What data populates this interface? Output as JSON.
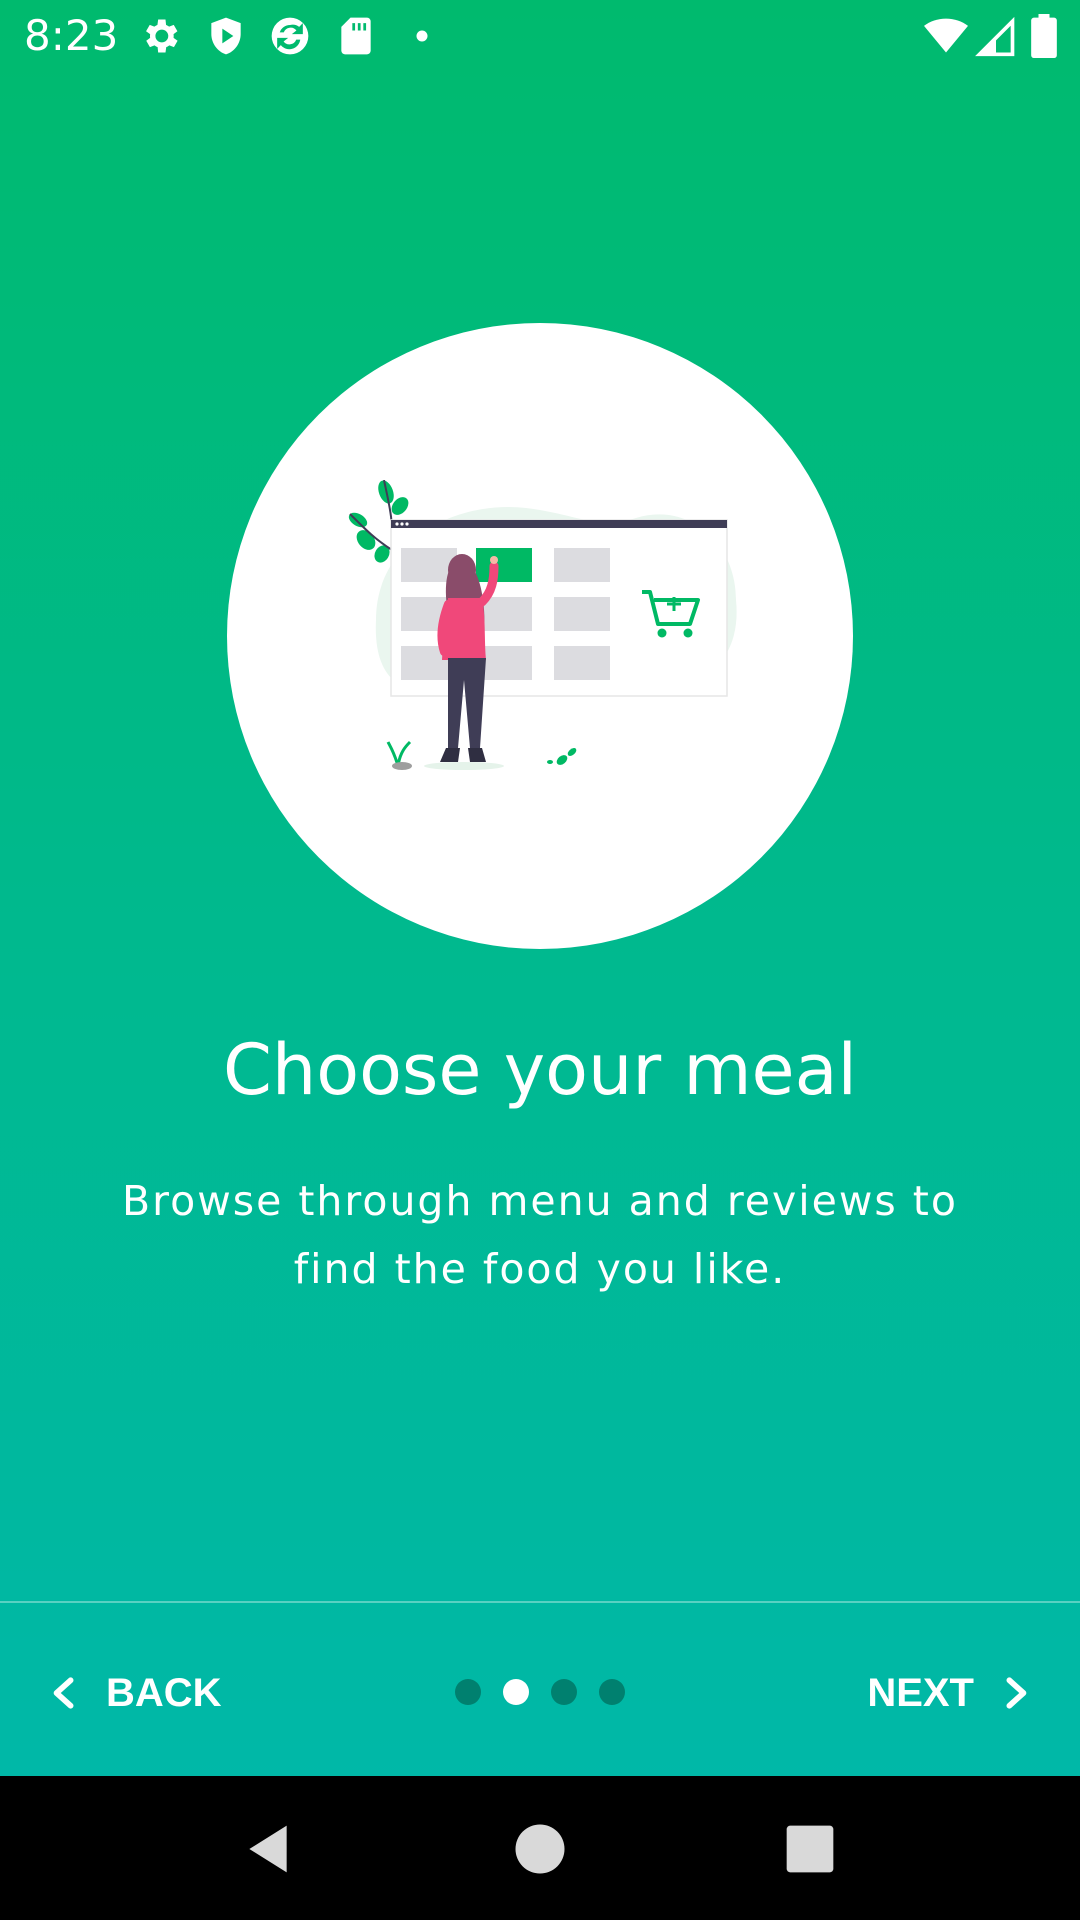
{
  "status_bar": {
    "time": "8:23",
    "icons_left": [
      "settings-gear-icon",
      "shield-play-icon",
      "sync-app-icon",
      "sd-card-icon",
      "notification-dot-icon"
    ],
    "icons_right": [
      "wifi-icon",
      "cell-signal-icon",
      "battery-icon"
    ]
  },
  "onboarding": {
    "illustration": "person-choosing-menu-item-with-cart-icon",
    "title": "Choose your meal",
    "description": "Browse through menu and reviews to find the food you like."
  },
  "navigation": {
    "back_label": "BACK",
    "next_label": "NEXT",
    "page_count": 4,
    "current_page": 2
  },
  "system_nav": {
    "buttons": [
      "back-triangle-icon",
      "home-circle-icon",
      "recents-square-icon"
    ]
  },
  "colors": {
    "gradient_top": "#00BA6E",
    "gradient_bottom": "#00B8AC",
    "accent_green": "#00B964",
    "dot_inactive": "#00806F",
    "dot_active": "#FFFFFF",
    "person_top": "#F0487A",
    "screen_panel": "#3F3D56"
  }
}
